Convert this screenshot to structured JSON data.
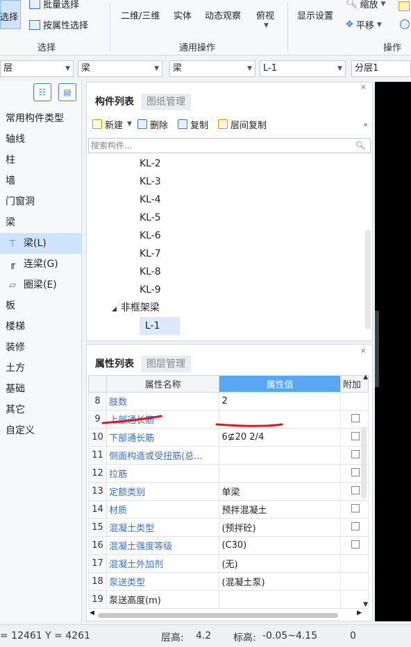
{
  "ribbon": {
    "select_group": {
      "big_label": "选择",
      "batch_select": "批量选择",
      "attr_select": "按属性选择",
      "group_label": "选择"
    },
    "common_ops": {
      "view_2d3d": "二维/三维",
      "solid": "实体",
      "dynamic_view": "动态观察",
      "top_view": "俯视",
      "group_label": "通用操作"
    },
    "ops": {
      "display_settings": "显示设置",
      "zoom": "缩放",
      "pan": "平移",
      "group_label": "操作"
    }
  },
  "filter_bar": {
    "floor": "层",
    "category": "梁",
    "type": "梁",
    "component": "L-1",
    "sublayer": "分层1"
  },
  "left_nav": {
    "items": [
      {
        "label": "常用构件类型"
      },
      {
        "label": "轴线"
      },
      {
        "label": "柱"
      },
      {
        "label": "墙"
      },
      {
        "label": "门窗洞"
      },
      {
        "label": "梁"
      },
      {
        "label": "梁(L)"
      },
      {
        "label": "连梁(G)"
      },
      {
        "label": "圈梁(E)"
      },
      {
        "label": "板"
      },
      {
        "label": "楼梯"
      },
      {
        "label": "装修"
      },
      {
        "label": "土方"
      },
      {
        "label": "基础"
      },
      {
        "label": "其它"
      },
      {
        "label": "自定义"
      }
    ]
  },
  "component_panel": {
    "tabs": [
      "构件列表",
      "图纸管理"
    ],
    "toolbar": {
      "new": "新建",
      "delete": "删除",
      "copy": "复制",
      "floor_copy": "层间复制",
      "more": "»"
    },
    "search_placeholder": "搜索构件...",
    "tree_items": [
      "KL-2",
      "KL-3",
      "KL-4",
      "KL-5",
      "KL-6",
      "KL-7",
      "KL-8",
      "KL-9"
    ],
    "group_label": "非框架梁",
    "selected_item": "L-1"
  },
  "property_panel": {
    "tabs": [
      "属性列表",
      "图层管理"
    ],
    "headers": {
      "name": "属性名称",
      "value": "属性值",
      "extra": "附加"
    },
    "rows": [
      {
        "num": "8",
        "name": "肢数",
        "value": "2",
        "check": false
      },
      {
        "num": "9",
        "name": "上部通长筋",
        "value": "",
        "check": true
      },
      {
        "num": "10",
        "name": "下部通长筋",
        "value": "6⊈20 2/4",
        "check": true
      },
      {
        "num": "11",
        "name": "侧面构造或受扭筋(总...",
        "value": "",
        "check": true
      },
      {
        "num": "12",
        "name": "拉筋",
        "value": "",
        "check": true
      },
      {
        "num": "13",
        "name": "定额类别",
        "value": "单梁",
        "check": true
      },
      {
        "num": "14",
        "name": "材质",
        "value": "预拌混凝土",
        "check": true
      },
      {
        "num": "15",
        "name": "混凝土类型",
        "value": "(预拌砼)",
        "check": true
      },
      {
        "num": "16",
        "name": "混凝土强度等级",
        "value": "(C30)",
        "check": true
      },
      {
        "num": "17",
        "name": "混凝土外加剂",
        "value": "(无)",
        "check": false
      },
      {
        "num": "18",
        "name": "泵送类型",
        "value": "(混凝土泵)",
        "check": false
      },
      {
        "num": "19",
        "name": "泵送高度(m)",
        "value": "",
        "check": false
      }
    ]
  },
  "status_bar": {
    "coords": "= 12461 Y = 4261",
    "floor_height_label": "层高:",
    "floor_height": "4.2",
    "elevation_label": "标高:",
    "elevation": "-0.05~4.15",
    "extra": "0"
  },
  "colors": {
    "accent": "#3a7bd5",
    "header_highlight": "#5aa6f2",
    "annotation": "#e0141e",
    "selection": "#cfe3fa"
  }
}
